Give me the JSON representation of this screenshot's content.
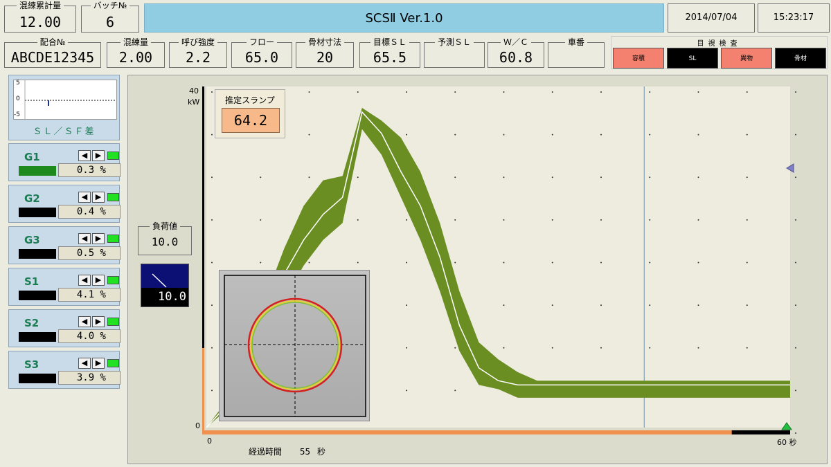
{
  "header": {
    "cumulative": {
      "label": "混練累計量",
      "value": "12.00"
    },
    "batch": {
      "label": "バッチ№",
      "value": "6"
    },
    "title": "SCSⅡ Ver.1.0",
    "date": "2014/07/04",
    "time": "15:23:17"
  },
  "fields": [
    {
      "label": "配合№",
      "value": "ABCDE12345"
    },
    {
      "label": "混練量",
      "value": "2.00"
    },
    {
      "label": "呼び強度",
      "value": "2.2"
    },
    {
      "label": "フロー",
      "value": "65.0"
    },
    {
      "label": "骨材寸法",
      "value": "20"
    },
    {
      "label": "目標ＳＬ",
      "value": "65.5"
    },
    {
      "label": "予測ＳＬ",
      "value": ""
    },
    {
      "label": "Ｗ／Ｃ",
      "value": "60.8"
    },
    {
      "label": "車番",
      "value": ""
    }
  ],
  "inspection": {
    "title": "目視検査",
    "buttons": [
      {
        "label": "容積",
        "color": "#f4816f"
      },
      {
        "label": "SL",
        "color": "#000000"
      },
      {
        "label": "異物",
        "color": "#f4816f"
      },
      {
        "label": "骨材",
        "color": "#000000"
      }
    ]
  },
  "slsf": {
    "label": "ＳＬ／ＳＦ差",
    "ticks": [
      "5",
      "0",
      "-5"
    ]
  },
  "gauges": [
    {
      "name": "G1",
      "value": "0.3 %",
      "bar_color": "#1e8a1e"
    },
    {
      "name": "G2",
      "value": "0.4 %",
      "bar_color": "#000000"
    },
    {
      "name": "G3",
      "value": "0.5 %",
      "bar_color": "#000000"
    },
    {
      "name": "S1",
      "value": "4.1 %",
      "bar_color": "#000000"
    },
    {
      "name": "S2",
      "value": "4.0 %",
      "bar_color": "#000000"
    },
    {
      "name": "S3",
      "value": "3.9 %",
      "bar_color": "#000000"
    }
  ],
  "load": {
    "label": "負荷値",
    "value": "10.0",
    "meter_value": "10.0"
  },
  "estimate": {
    "label": "推定スランプ",
    "value": "64.2"
  },
  "chart_data": {
    "type": "area",
    "y_top_label": "40",
    "y_unit": "kW",
    "y_bottom_label": "0",
    "x_start_label": "0",
    "x_end_label": "60 秒",
    "ylim": [
      0,
      40
    ],
    "xlim": [
      0,
      60
    ],
    "elapsed": {
      "label": "経過時間",
      "value": "55",
      "unit": "秒"
    },
    "x": [
      0,
      2,
      4,
      6,
      8,
      10,
      12,
      14,
      16,
      18,
      20,
      22,
      24,
      26,
      28,
      30,
      32,
      34,
      36,
      38,
      40,
      42,
      44,
      46,
      48,
      50,
      52,
      54,
      56,
      58,
      60
    ],
    "upper": [
      0,
      3,
      9,
      15,
      21,
      26,
      29,
      29.5,
      37.5,
      36,
      34,
      30,
      24,
      16,
      10,
      8,
      6.5,
      5.5,
      5.5,
      5.5,
      5.5,
      5.5,
      5.5,
      5.5,
      5.5,
      5.5,
      5.5,
      5.5,
      5.5,
      5.5,
      5.5
    ],
    "center": [
      0,
      2.5,
      8,
      13,
      18,
      22,
      25,
      27,
      37,
      34.5,
      30,
      26,
      20,
      12,
      7,
      5.5,
      5,
      5,
      5,
      5,
      5,
      5,
      5,
      5,
      5,
      5,
      5,
      5,
      5,
      5,
      5
    ],
    "lower": [
      0,
      2,
      6,
      11,
      15,
      19,
      22,
      24,
      35,
      32,
      27,
      22,
      16,
      9,
      5,
      4.5,
      3.5,
      3.5,
      3.5,
      3.5,
      3.5,
      3.5,
      3.5,
      3.5,
      3.5,
      3.5,
      3.5,
      3.5,
      3.5,
      3.5,
      3.5
    ],
    "band_color": "#6b8e23",
    "line_color": "#ffffff",
    "current_marker": 60
  }
}
